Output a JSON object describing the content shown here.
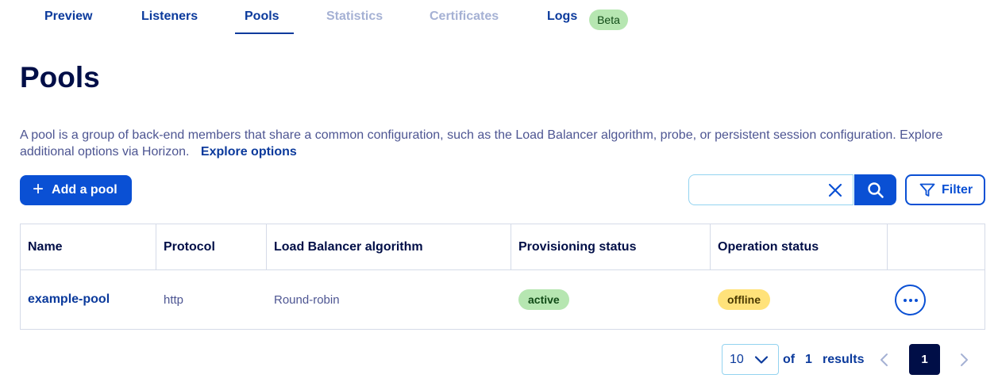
{
  "tabs": [
    {
      "label": "Preview",
      "state": "enabled"
    },
    {
      "label": "Listeners",
      "state": "enabled"
    },
    {
      "label": "Pools",
      "state": "active"
    },
    {
      "label": "Statistics",
      "state": "disabled"
    },
    {
      "label": "Certificates",
      "state": "disabled"
    },
    {
      "label": "Logs",
      "state": "enabled",
      "badge": "Beta"
    }
  ],
  "page": {
    "title": "Pools",
    "description": "A pool is a group of back-end members that share a common configuration, such as the Load Balancer algorithm, probe, or persistent session configuration. Explore additional options via Horizon.",
    "explore_link": "Explore options"
  },
  "toolbar": {
    "add_label": "Add a pool",
    "search_value": "",
    "filter_label": "Filter"
  },
  "table": {
    "headers": [
      "Name",
      "Protocol",
      "Load Balancer algorithm",
      "Provisioning status",
      "Operation status"
    ],
    "rows": [
      {
        "name": "example-pool",
        "protocol": "http",
        "algorithm": "Round-robin",
        "provisioning_status": "active",
        "operation_status": "offline"
      }
    ]
  },
  "pagination": {
    "page_size": "10",
    "of_label": "of",
    "total_pages": "1",
    "results_label": "results",
    "current_page": "1"
  },
  "colors": {
    "primary": "#0a50d4",
    "navy": "#000e47",
    "active_badge": "#b6e6b1",
    "offline_badge": "#ffe27a"
  },
  "icons": [
    "plus-icon",
    "close-icon",
    "search-icon",
    "filter-icon",
    "more-icon",
    "chevron-down-icon",
    "chevron-left-icon",
    "chevron-right-icon"
  ]
}
